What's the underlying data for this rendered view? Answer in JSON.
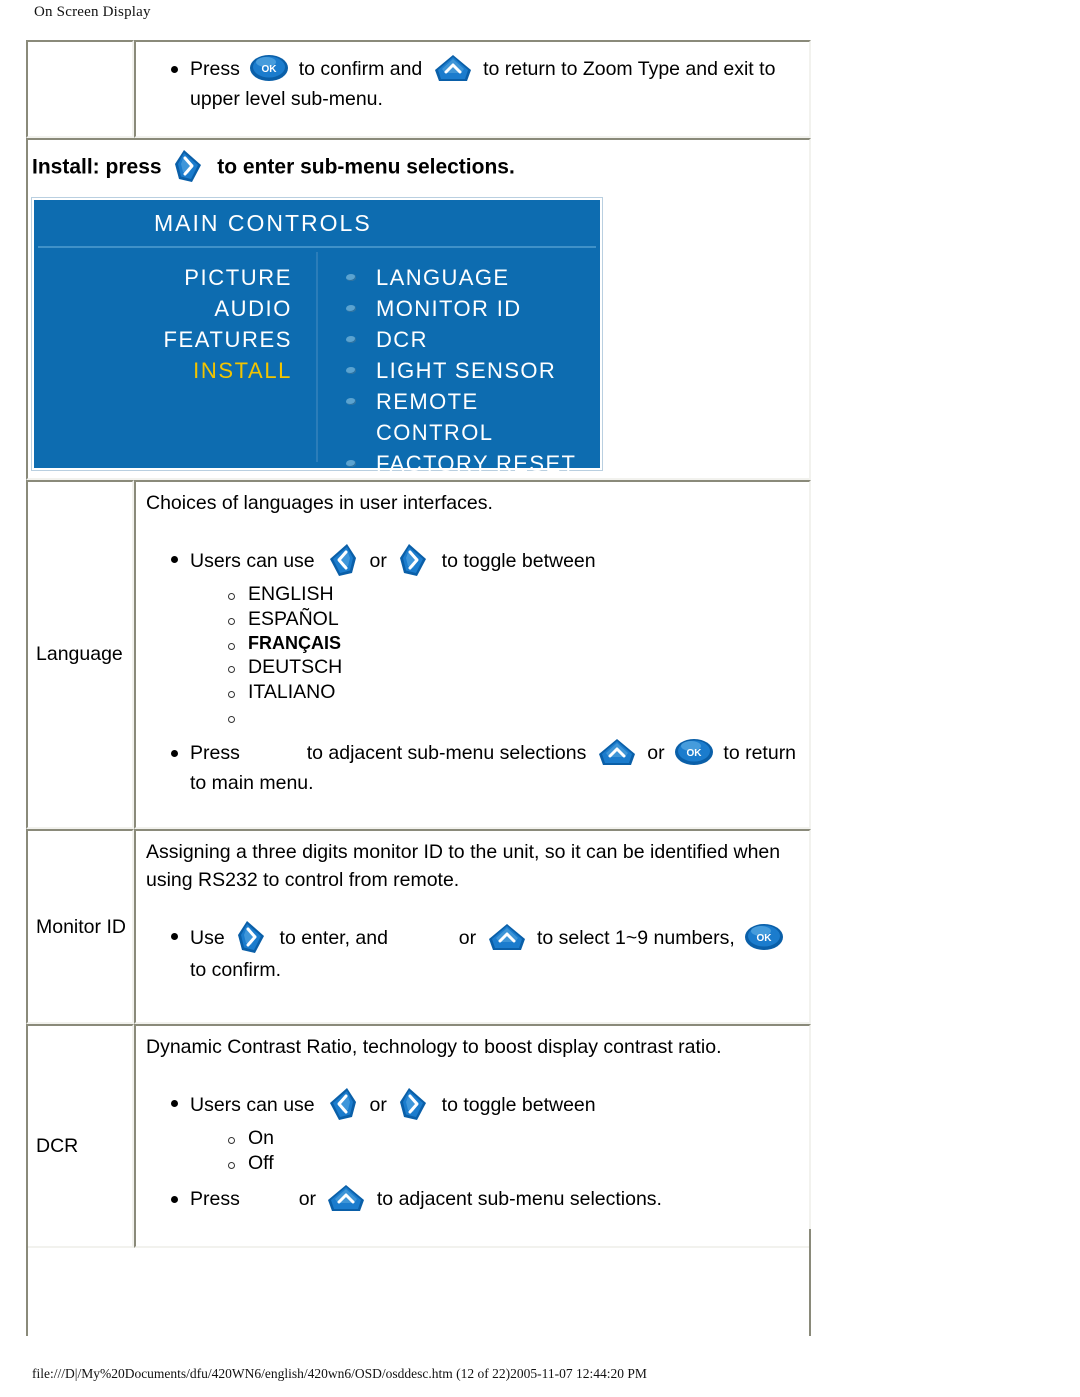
{
  "page": {
    "header": "On Screen Display",
    "footer": "file:///D|/My%20Documents/dfu/420WN6/english/420wn6/OSD/osddesc.htm (12 of 22)2005-11-07 12:44:20 PM"
  },
  "colors": {
    "osd_background": "#0D6CB0",
    "osd_selected_text": "#F2C400",
    "osd_text": "#FFFFFF",
    "button_blue": "#1E7FD0"
  },
  "row_zoom": {
    "bullet_1_a": "Press",
    "bullet_1_b": "to confirm and",
    "bullet_1_c": "to return to Zoom Type and exit to upper level sub-menu."
  },
  "install_heading": {
    "before": "Install: press",
    "after": "to enter sub-menu selections."
  },
  "osd": {
    "title": "MAIN CONTROLS",
    "left_items": [
      {
        "label": "PICTURE",
        "selected": false
      },
      {
        "label": "AUDIO",
        "selected": false
      },
      {
        "label": "FEATURES",
        "selected": false
      },
      {
        "label": "INSTALL",
        "selected": true
      }
    ],
    "right_items": [
      "LANGUAGE",
      "MONITOR ID",
      "DCR",
      "LIGHT SENSOR",
      "REMOTE CONTROL",
      "FACTORY RESET"
    ]
  },
  "rows": [
    {
      "label": "Language",
      "intro": "Choices of languages in user interfaces.",
      "bullet_a_pre": "Users can use",
      "bullet_a_mid": "or",
      "bullet_a_post": "to toggle between",
      "options": [
        "ENGLISH",
        "ESPAÑOL",
        "FRANÇAIS",
        "DEUTSCH",
        "ITALIANO",
        ""
      ],
      "bullet_b_pre": "Press",
      "bullet_b_mid": "to adjacent sub-menu selections",
      "bullet_b_or": "or",
      "bullet_b_post": "to return to main menu."
    },
    {
      "label": "Monitor ID",
      "intro": "Assigning a three digits monitor ID to the unit, so it can be identified when using RS232 to control from remote.",
      "bullet_a_pre": "Use",
      "bullet_a_mid": "to enter, and",
      "bullet_a_or": "or",
      "bullet_a_post": "to select 1~9 numbers,",
      "bullet_a_end": "to confirm."
    },
    {
      "label": "DCR",
      "intro": "Dynamic Contrast Ratio, technology to boost display contrast ratio.",
      "bullet_a_pre": "Users can use",
      "bullet_a_mid": "or",
      "bullet_a_post": "to toggle between",
      "options": [
        "On",
        "Off"
      ],
      "bullet_b_pre": "Press",
      "bullet_b_or": "or",
      "bullet_b_post": "to adjacent sub-menu selections."
    }
  ]
}
